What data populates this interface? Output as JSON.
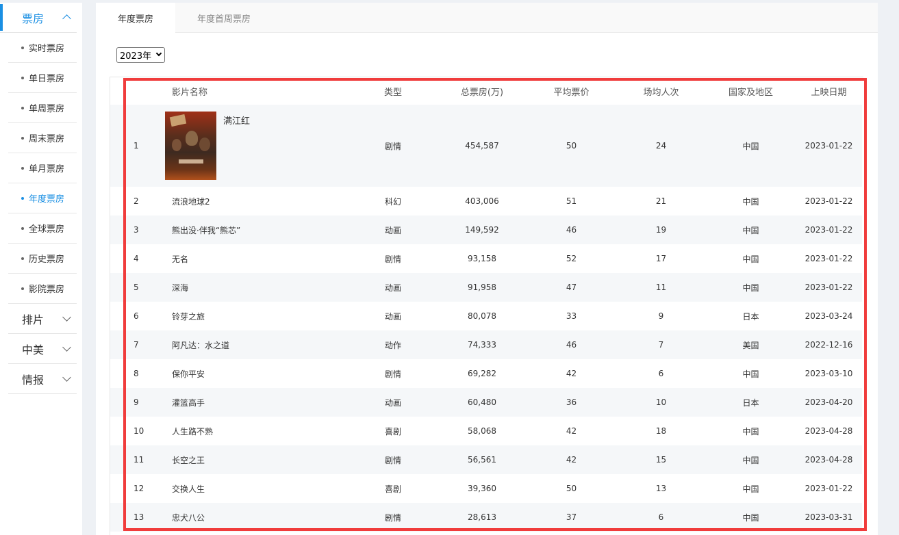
{
  "sidebar": {
    "box_office": {
      "label": "票房",
      "items": [
        {
          "label": "实时票房"
        },
        {
          "label": "单日票房"
        },
        {
          "label": "单周票房"
        },
        {
          "label": "周末票房"
        },
        {
          "label": "单月票房"
        },
        {
          "label": "年度票房"
        },
        {
          "label": "全球票房"
        },
        {
          "label": "历史票房"
        },
        {
          "label": "影院票房"
        }
      ]
    },
    "sections": [
      {
        "label": "排片"
      },
      {
        "label": "中美"
      },
      {
        "label": "情报"
      }
    ]
  },
  "tabs": [
    {
      "label": "年度票房"
    },
    {
      "label": "年度首周票房"
    }
  ],
  "year_select": {
    "value": "2023年"
  },
  "table": {
    "headers": {
      "name": "影片名称",
      "genre": "类型",
      "gross": "总票房(万)",
      "avg_price": "平均票价",
      "avg_attendance": "场均人次",
      "region": "国家及地区",
      "release": "上映日期"
    },
    "rows": [
      {
        "rank": "1",
        "name": "满江红",
        "genre": "剧情",
        "gross": "454,587",
        "avg_price": "50",
        "avg_attendance": "24",
        "region": "中国",
        "release": "2023-01-22"
      },
      {
        "rank": "2",
        "name": "流浪地球2",
        "genre": "科幻",
        "gross": "403,006",
        "avg_price": "51",
        "avg_attendance": "21",
        "region": "中国",
        "release": "2023-01-22"
      },
      {
        "rank": "3",
        "name": "熊出没·伴我“熊芯”",
        "genre": "动画",
        "gross": "149,592",
        "avg_price": "46",
        "avg_attendance": "19",
        "region": "中国",
        "release": "2023-01-22"
      },
      {
        "rank": "4",
        "name": "无名",
        "genre": "剧情",
        "gross": "93,158",
        "avg_price": "52",
        "avg_attendance": "17",
        "region": "中国",
        "release": "2023-01-22"
      },
      {
        "rank": "5",
        "name": "深海",
        "genre": "动画",
        "gross": "91,958",
        "avg_price": "47",
        "avg_attendance": "11",
        "region": "中国",
        "release": "2023-01-22"
      },
      {
        "rank": "6",
        "name": "铃芽之旅",
        "genre": "动画",
        "gross": "80,078",
        "avg_price": "33",
        "avg_attendance": "9",
        "region": "日本",
        "release": "2023-03-24"
      },
      {
        "rank": "7",
        "name": "阿凡达：水之道",
        "genre": "动作",
        "gross": "74,333",
        "avg_price": "46",
        "avg_attendance": "7",
        "region": "美国",
        "release": "2022-12-16"
      },
      {
        "rank": "8",
        "name": "保你平安",
        "genre": "剧情",
        "gross": "69,282",
        "avg_price": "42",
        "avg_attendance": "6",
        "region": "中国",
        "release": "2023-03-10"
      },
      {
        "rank": "9",
        "name": "灌篮高手",
        "genre": "动画",
        "gross": "60,480",
        "avg_price": "36",
        "avg_attendance": "10",
        "region": "日本",
        "release": "2023-04-20"
      },
      {
        "rank": "10",
        "name": "人生路不熟",
        "genre": "喜剧",
        "gross": "58,068",
        "avg_price": "42",
        "avg_attendance": "18",
        "region": "中国",
        "release": "2023-04-28"
      },
      {
        "rank": "11",
        "name": "长空之王",
        "genre": "剧情",
        "gross": "56,561",
        "avg_price": "42",
        "avg_attendance": "15",
        "region": "中国",
        "release": "2023-04-28"
      },
      {
        "rank": "12",
        "name": "交换人生",
        "genre": "喜剧",
        "gross": "39,360",
        "avg_price": "50",
        "avg_attendance": "13",
        "region": "中国",
        "release": "2023-01-22"
      },
      {
        "rank": "13",
        "name": "忠犬八公",
        "genre": "剧情",
        "gross": "28,613",
        "avg_price": "37",
        "avg_attendance": "6",
        "region": "中国",
        "release": "2023-03-31"
      }
    ]
  },
  "colors": {
    "accent": "#1a8fe3",
    "highlight_box": "#f03c3c"
  }
}
